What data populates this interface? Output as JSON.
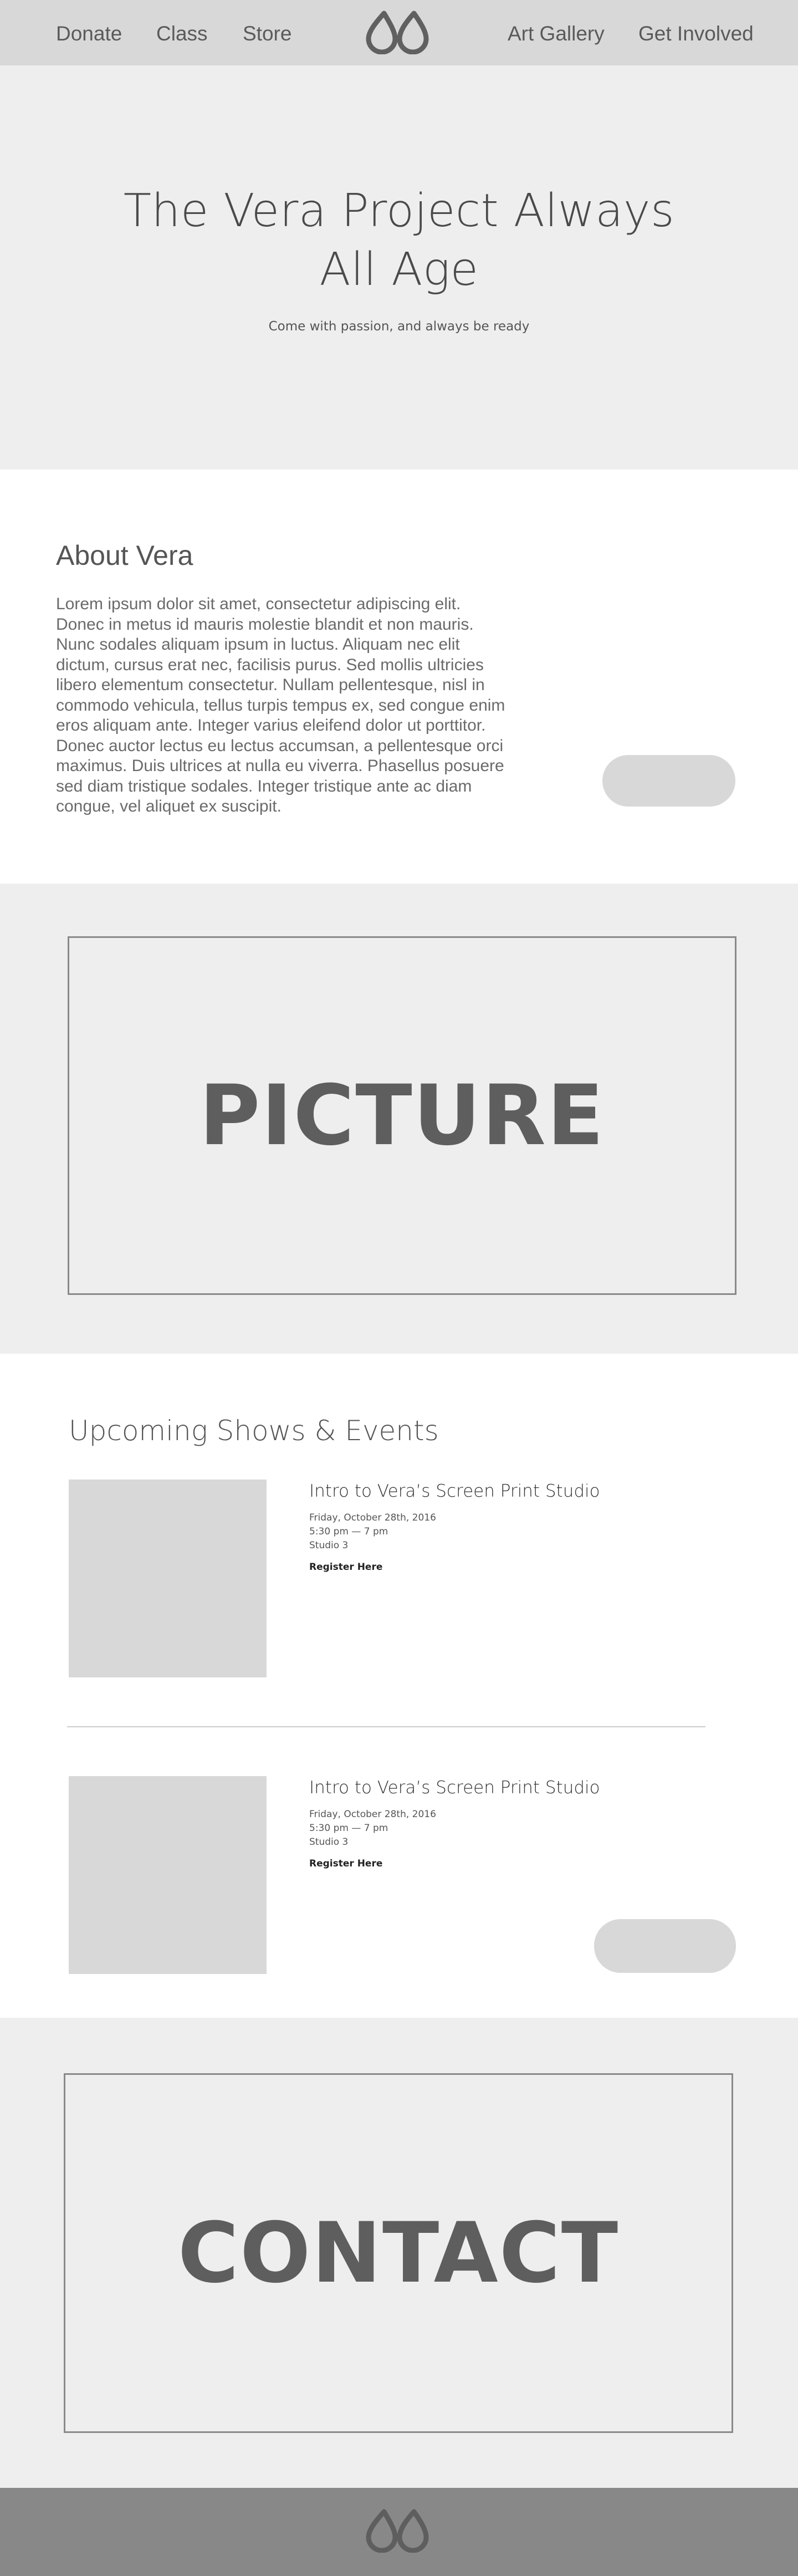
{
  "nav": {
    "left": [
      "Donate",
      "Class",
      "Store"
    ],
    "right": [
      "Art Gallery",
      "Get Involved"
    ],
    "logo_icon": "vera-logo-icon"
  },
  "hero": {
    "title_line1": "The Vera Project Always",
    "title_line2": "All Age",
    "subtitle": "Come with passion, and always be ready"
  },
  "about": {
    "title": "About Vera",
    "body": "Lorem ipsum dolor sit amet, consectetur adipiscing elit. Donec in metus id mauris molestie blandit et non mauris. Nunc sodales aliquam ipsum in luctus. Aliquam nec elit dictum, cursus erat nec, facilisis purus. Sed mollis ultricies libero elementum consectetur. Nullam pellentesque, nisl in commodo vehicula, tellus turpis tempus ex, sed congue enim eros aliquam ante. Integer varius eleifend dolor ut porttitor. Donec auctor lectus eu lectus accumsan, a pellentesque orci maximus. Duis ultrices at nulla eu viverra. Phasellus posuere sed diam tristique sodales. Integer tristique ante ac diam congue, vel aliquet ex suscipit."
  },
  "picture": {
    "label": "PICTURE"
  },
  "events": {
    "title": "Upcoming Shows & Events",
    "items": [
      {
        "name": "Intro to Vera’s Screen Print Studio",
        "date": "Friday, October 28th, 2016",
        "time": "5:30 pm — 7 pm",
        "location": "Studio 3",
        "link": "Register Here"
      },
      {
        "name": "Intro to Vera’s Screen Print Studio",
        "date": "Friday, October 28th, 2016",
        "time": "5:30 pm — 7 pm",
        "location": "Studio 3",
        "link": "Register Here"
      }
    ]
  },
  "contact": {
    "label": "CONTACT"
  },
  "colors": {
    "nav_bg": "#d8d8d8",
    "section_gray": "#eeeeee",
    "placeholder": "#d8d8d8",
    "footer_bg": "#888888",
    "text": "#555555"
  }
}
